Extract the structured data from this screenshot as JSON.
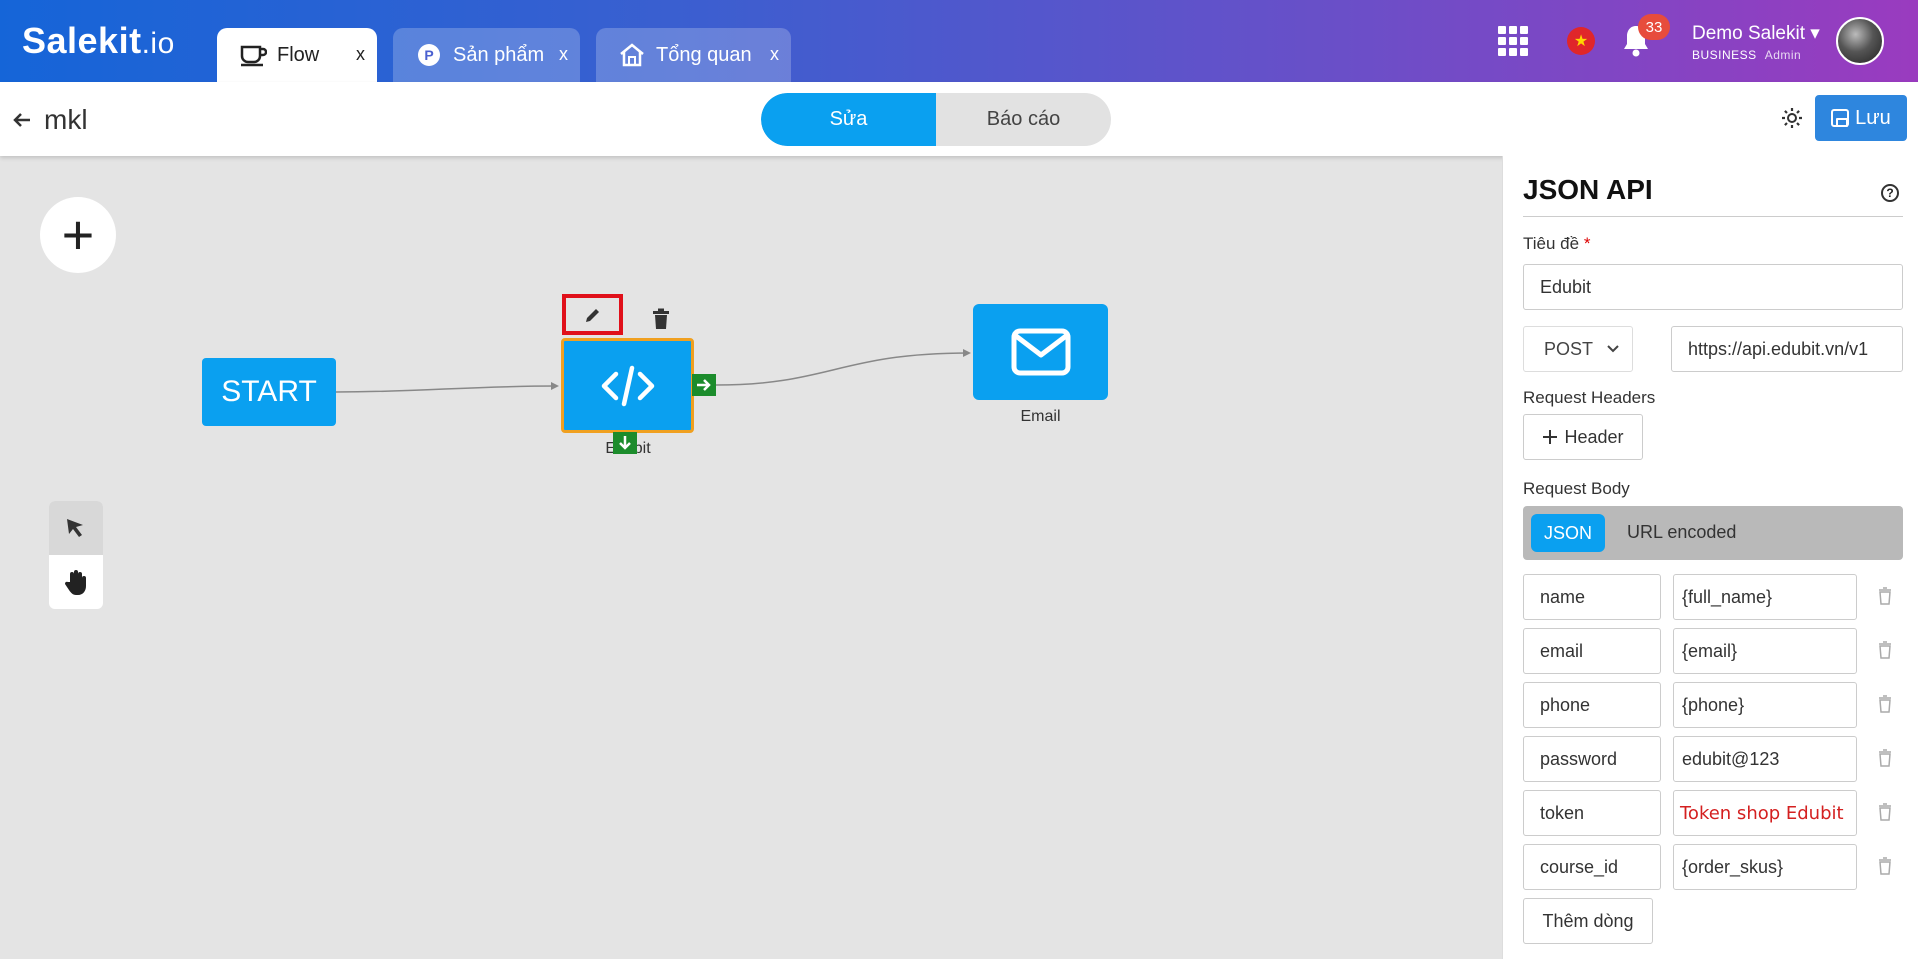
{
  "brand": {
    "name": "Salekit",
    "suffix": ".io"
  },
  "tabs": [
    {
      "label": "Flow",
      "close": "x",
      "icon": "coffee-cup-icon"
    },
    {
      "label": "Sản phẩm",
      "close": "x",
      "icon": "product-p-icon"
    },
    {
      "label": "Tổng quan",
      "close": "x",
      "icon": "home-icon"
    }
  ],
  "header": {
    "notifications": "33",
    "user_name": "Demo Salekit",
    "plan": "BUSINESS",
    "role": "Admin",
    "flag": "★"
  },
  "subheader": {
    "title": "mkl",
    "mode_edit": "Sửa",
    "mode_report": "Báo cáo",
    "save_label": "Lưu"
  },
  "canvas": {
    "start_label": "START",
    "api_node_label": "Edubit",
    "email_node_label": "Email"
  },
  "panel": {
    "title": "JSON API",
    "title_field_label": "Tiêu đề",
    "required_mark": "*",
    "title_value": "Edubit",
    "method": "POST",
    "url": "https://api.edubit.vn/v1",
    "headers_label": "Request Headers",
    "add_header_label": "Header",
    "body_label": "Request Body",
    "body_types": [
      "JSON",
      "URL encoded"
    ],
    "rows": [
      {
        "key": "name",
        "value": "{full_name}"
      },
      {
        "key": "email",
        "value": "{email}"
      },
      {
        "key": "phone",
        "value": "{phone}"
      },
      {
        "key": "password",
        "value": "edubit@123"
      },
      {
        "key": "token",
        "value": "Token shop Edubit"
      },
      {
        "key": "course_id",
        "value": "{order_skus}"
      }
    ],
    "add_row_label": "Thêm dòng"
  }
}
